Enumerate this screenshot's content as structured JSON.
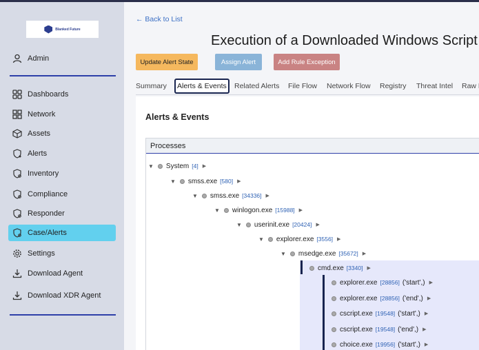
{
  "sidebar": {
    "logo_text": "Blanked Future",
    "user": "Admin",
    "items": [
      {
        "label": "Dashboards",
        "icon": "dashboard-icon"
      },
      {
        "label": "Network",
        "icon": "network-icon"
      },
      {
        "label": "Assets",
        "icon": "cube-icon"
      },
      {
        "label": "Alerts",
        "icon": "shield-alert-icon"
      },
      {
        "label": "Inventory",
        "icon": "shield-icon"
      },
      {
        "label": "Compliance",
        "icon": "shield-icon"
      },
      {
        "label": "Responder",
        "icon": "shield-icon"
      },
      {
        "label": "Case/Alerts",
        "icon": "shield-icon",
        "active": true
      },
      {
        "label": "Settings",
        "icon": "gear-icon"
      },
      {
        "label": "Download Agent",
        "icon": "download-icon"
      },
      {
        "label": "Download XDR Agent",
        "icon": "download-icon"
      }
    ]
  },
  "header": {
    "back_link": "← Back to List",
    "title": "Execution of a Downloaded Windows Script"
  },
  "actions": {
    "update": "Update Alert State",
    "assign": "Assign Alert",
    "exception": "Add Rule Exception"
  },
  "tabs": [
    "Summary",
    "Alerts & Events",
    "Related Alerts",
    "File Flow",
    "Network Flow",
    "Registry",
    "Threat Intel",
    "Raw D"
  ],
  "active_tab": "Alerts & Events",
  "section": {
    "title": "Alerts & Events",
    "processes_header": "Processes"
  },
  "tree": [
    {
      "name": "System",
      "pid": "[4]",
      "arg": ""
    },
    {
      "name": "smss.exe",
      "pid": "[580]",
      "arg": ""
    },
    {
      "name": "smss.exe",
      "pid": "[34336]",
      "arg": ""
    },
    {
      "name": "winlogon.exe",
      "pid": "[15988]",
      "arg": ""
    },
    {
      "name": "userinit.exe",
      "pid": "[20424]",
      "arg": ""
    },
    {
      "name": "explorer.exe",
      "pid": "[3556]",
      "arg": ""
    },
    {
      "name": "msedge.exe",
      "pid": "[35672]",
      "arg": ""
    },
    {
      "name": "cmd.exe",
      "pid": "[3340]",
      "arg": ""
    },
    {
      "name": "explorer.exe",
      "pid": "[28856]",
      "arg": "('start',)"
    },
    {
      "name": "explorer.exe",
      "pid": "[28856]",
      "arg": "('end',)"
    },
    {
      "name": "cscript.exe",
      "pid": "[19548]",
      "arg": "('start',)"
    },
    {
      "name": "cscript.exe",
      "pid": "[19548]",
      "arg": "('end',)"
    },
    {
      "name": "choice.exe",
      "pid": "[19956]",
      "arg": "('start',)"
    }
  ],
  "colors": {
    "active_nav": "#62d0ee",
    "update_btn": "#f5b85e",
    "assign_btn": "#8ab4d8",
    "exception_btn": "#c98383",
    "pid": "#2f62b4"
  }
}
